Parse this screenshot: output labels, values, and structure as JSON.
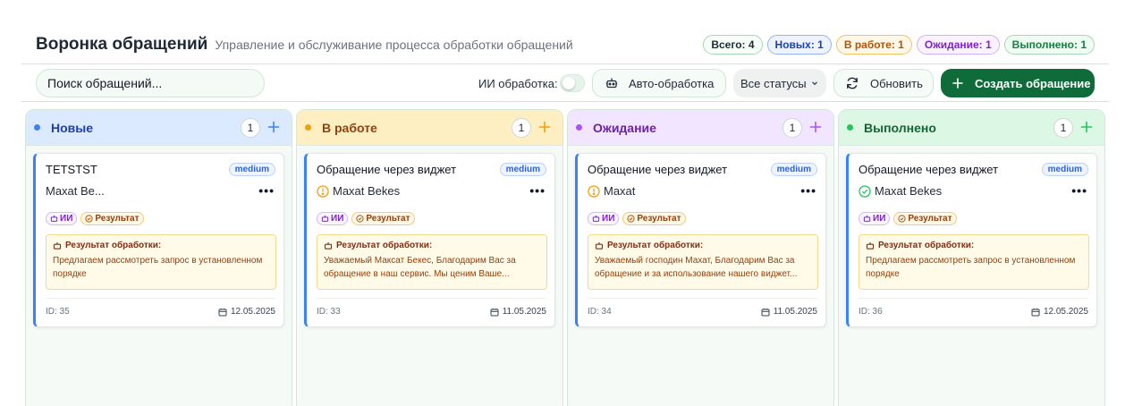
{
  "header": {
    "title": "Воронка обращений",
    "subtitle": "Управление и обслуживание процесса обработки обращений",
    "stats": {
      "total": "Всего: 4",
      "new": "Новых: 1",
      "in_work": "В работе: 1",
      "waiting": "Ожидание: 1",
      "done": "Выполнено: 1"
    }
  },
  "toolbar": {
    "search_placeholder": "Поиск обращений...",
    "ai_label": "ИИ обработка:",
    "auto_button": "Авто-обработка",
    "status_select": "Все статусы",
    "refresh_button": "Обновить",
    "create_button": "Создать обращение"
  },
  "columns": [
    {
      "title": "Новые",
      "count": "1",
      "color": "#3b82f6",
      "card": {
        "title": "TETSTST",
        "priority": "medium",
        "person": "Maxat Be...",
        "person_icon": "none",
        "tag_ai": "ИИ",
        "tag_result": "Результат",
        "result_title": "Результат обработки:",
        "result_text": "Предлагаем рассмотреть запрос в установленном порядке",
        "id": "ID: 35",
        "date": "12.05.2025"
      }
    },
    {
      "title": "В работе",
      "count": "1",
      "color": "#f59e0b",
      "card": {
        "title": "Обращение через виджет",
        "priority": "medium",
        "person": "Maxat Bekes",
        "person_icon": "alert-circle-icon",
        "tag_ai": "ИИ",
        "tag_result": "Результат",
        "result_title": "Результат обработки:",
        "result_text": "Уважаемый Максат Бекес, Благодарим Вас за обращение в наш сервис. Мы ценим Ваше...",
        "id": "ID: 33",
        "date": "11.05.2025"
      }
    },
    {
      "title": "Ожидание",
      "count": "1",
      "color": "#a855f7",
      "card": {
        "title": "Обращение через виджет",
        "priority": "medium",
        "person": "Maxat",
        "person_icon": "alert-circle-icon",
        "tag_ai": "ИИ",
        "tag_result": "Результат",
        "result_title": "Результат обработки:",
        "result_text": "Уважаемый господин Махат, Благодарим Вас за обращение и за использование нашего виджет...",
        "id": "ID: 34",
        "date": "11.05.2025"
      }
    },
    {
      "title": "Выполнено",
      "count": "1",
      "color": "#22c55e",
      "card": {
        "title": "Обращение через виджет",
        "priority": "medium",
        "person": "Maxat Bekes",
        "person_icon": "check-circle-icon",
        "tag_ai": "ИИ",
        "tag_result": "Результат",
        "result_title": "Результат обработки:",
        "result_text": "Предлагаем рассмотреть запрос в установленном порядке",
        "id": "ID: 36",
        "date": "12.05.2025"
      }
    }
  ]
}
